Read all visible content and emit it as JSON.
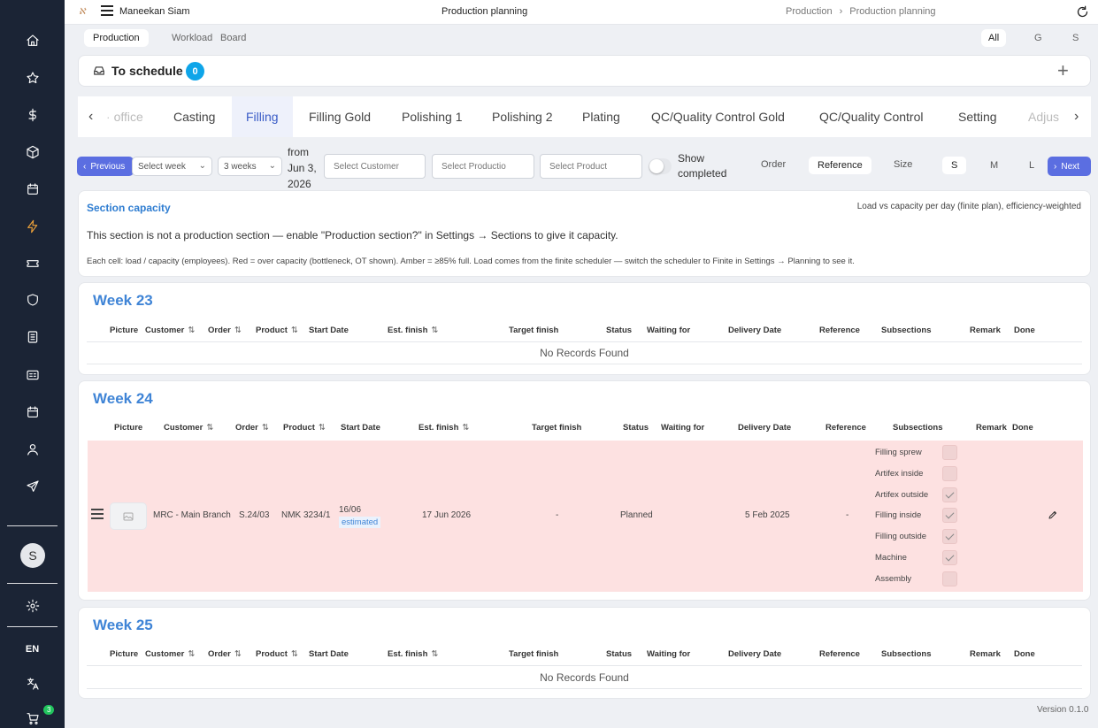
{
  "sidebar": {
    "icons": [
      "home-icon",
      "star-icon",
      "dollar-icon",
      "package-icon",
      "calendar-icon",
      "bolt-icon",
      "ticket-icon",
      "shield-icon",
      "document-icon",
      "id-card-icon",
      "calendar-icon",
      "user-icon",
      "send-icon"
    ],
    "avatar_initial": "S",
    "language": "EN",
    "cart_count": "3"
  },
  "topbar": {
    "user_name": "Maneekan Siam",
    "page_title": "Production planning",
    "breadcrumb": [
      "Production",
      "Production planning"
    ]
  },
  "view_tabs": [
    "Production",
    "Workload",
    "Board"
  ],
  "filter_chips": [
    "All",
    "G",
    "S"
  ],
  "to_schedule": {
    "label": "To schedule",
    "count": "0"
  },
  "section_tabs": [
    "office",
    "Casting",
    "Filling",
    "Filling Gold",
    "Polishing 1",
    "Polishing 2",
    "Plating",
    "QC/Quality Control Gold",
    "QC/Quality Control",
    "Setting",
    "Adjus"
  ],
  "active_section": "Filling",
  "filters": {
    "previous": "Previous",
    "next": "Next",
    "select_week_placeholder": "Select week",
    "weeks": "3 weeks",
    "from_text": "from Jun 3, 2026",
    "customer_placeholder": "Select Customer",
    "production_placeholder": "Select Productio",
    "product_placeholder": "Select Product",
    "show_completed": "Show completed",
    "order_label": "Order",
    "reference_label": "Reference",
    "size_label": "Size",
    "sizes": [
      "S",
      "M",
      "L"
    ]
  },
  "capacity": {
    "title": "Section capacity",
    "legend": "Load vs capacity per day (finite plan), efficiency-weighted",
    "message": "This section is not a production section — enable \"Production section?\" in Settings → Sections to give it capacity.",
    "note": "Each cell: load / capacity (employees). Red = over capacity (bottleneck, OT shown). Amber = ≥85% full. Load comes from the finite scheduler — switch the scheduler to Finite in Settings → Planning to see it."
  },
  "columns": [
    "Picture",
    "Customer",
    "Order",
    "Product",
    "Start Date",
    "Est. finish",
    "Target finish",
    "Status",
    "Waiting for",
    "Delivery Date",
    "Reference",
    "Subsections",
    "Remark",
    "Done"
  ],
  "weeks": [
    {
      "title": "Week 23",
      "empty": "No Records Found"
    },
    {
      "title": "Week 24",
      "row": {
        "customer": "MRC - Main Branch",
        "order": "S.24/03",
        "product": "NMK 3234/1",
        "start_date": "16/06",
        "start_badge": "estimated",
        "est_finish": "17 Jun 2026",
        "target_finish": "-",
        "status": "Planned",
        "delivery_date": "5 Feb 2025",
        "reference": "-",
        "subsections": [
          {
            "label": "Filling sprew",
            "checked": false
          },
          {
            "label": "Artifex inside",
            "checked": false
          },
          {
            "label": "Artifex outside",
            "checked": true
          },
          {
            "label": "Filling inside",
            "checked": true
          },
          {
            "label": "Filling outside",
            "checked": true
          },
          {
            "label": "Machine",
            "checked": true
          },
          {
            "label": "Assembly",
            "checked": false
          }
        ]
      }
    },
    {
      "title": "Week 25",
      "empty": "No Records Found"
    }
  ],
  "version": "Version 0.1.0",
  "colors": {
    "sidebar": "#1b2435",
    "accent": "#5b6ee1",
    "week_title": "#3f84d6",
    "row_highlight": "#fde1e1",
    "badge": "#0ea5e9"
  }
}
